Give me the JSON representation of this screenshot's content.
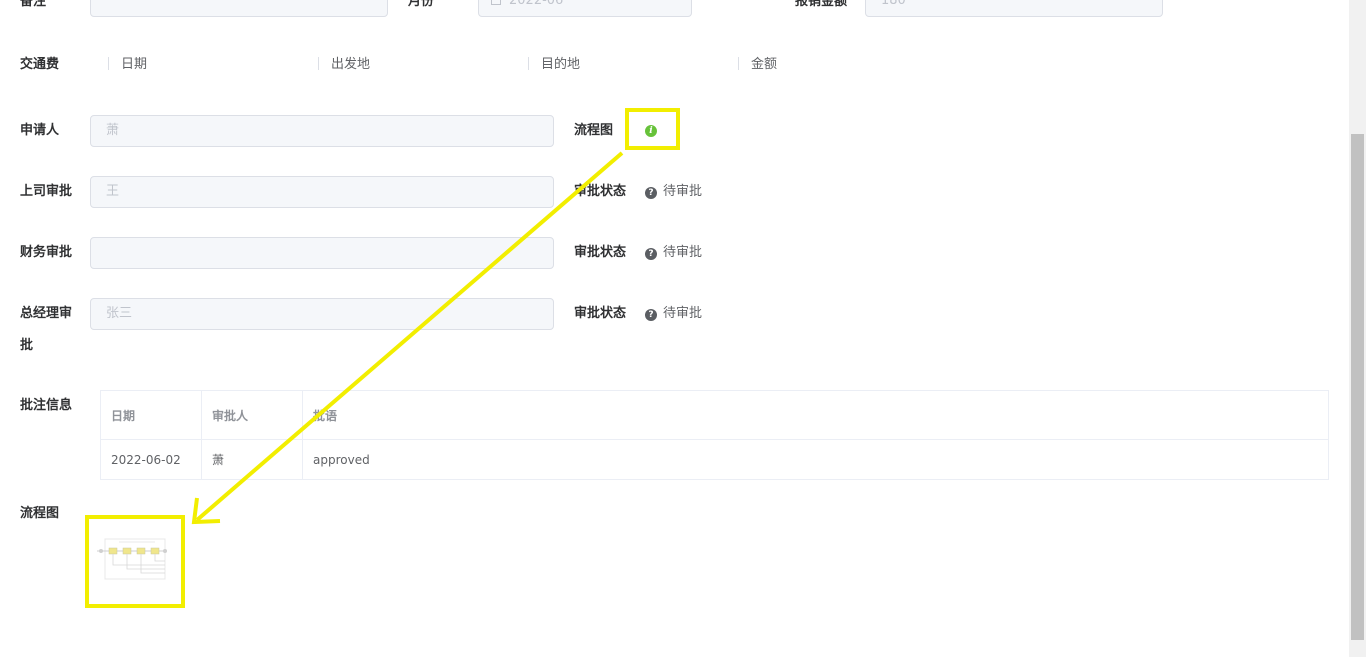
{
  "top_row": {
    "remark_label": "备注",
    "remark_value": "",
    "month_label": "月份",
    "month_value": "2022-06",
    "amount_label": "报销金额",
    "amount_value": "180"
  },
  "travel": {
    "label": "交通费",
    "columns": [
      "日期",
      "出发地",
      "目的地",
      "金额"
    ]
  },
  "applicant": {
    "label": "申请人",
    "value": "萧",
    "flow_label": "流程图",
    "flow_icon": "info-icon"
  },
  "approvals": [
    {
      "label": "上司审批",
      "value": "王",
      "status_label": "审批状态",
      "status": "待审批"
    },
    {
      "label": "财务审批",
      "value": "",
      "status_label": "审批状态",
      "status": "待审批"
    },
    {
      "label": "总经理审批",
      "value": "张三",
      "status_label": "审批状态",
      "status": "待审批"
    }
  ],
  "comments": {
    "label": "批注信息",
    "headers": [
      "日期",
      "审批人",
      "批语"
    ],
    "rows": [
      [
        "2022-06-02",
        "萧",
        "approved"
      ]
    ]
  },
  "flowchart": {
    "label": "流程图"
  },
  "colors": {
    "highlight": "#f2ee00",
    "info_icon": "#67c23a"
  }
}
